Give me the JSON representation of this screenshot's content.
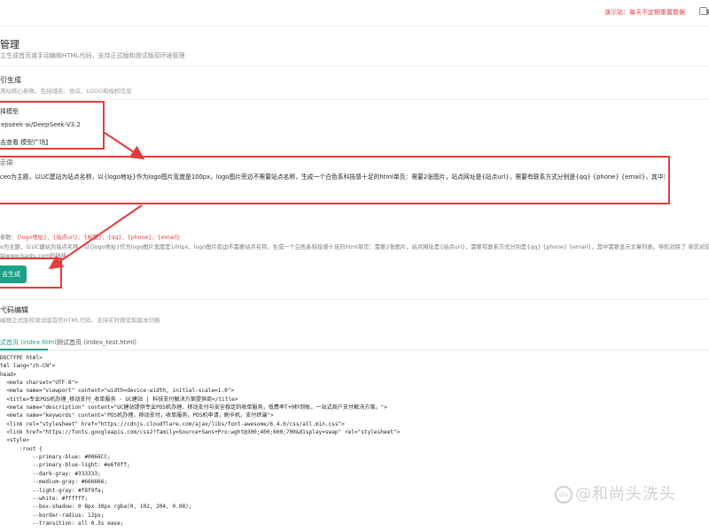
{
  "topbar": {
    "demo_notice": "演示站：每天不定期重置数据",
    "tail_text": "量"
  },
  "header": {
    "title": "管理",
    "subtitle": "立生成首页或手动编辑HTML代码，支持正式版和测试版双环境管理"
  },
  "generate_section": {
    "title": "引生成",
    "subtitle": "用站核心参数，包括域名、协议、LOGO和授权信息",
    "model_label": "择模型",
    "model_value": "epseek-ai/DeepSeek-V3.2",
    "model_link": "击查看 模型广场】",
    "prompt_label": "示词",
    "prompt_text": "ceo为主题，以UC建站为站点名称，以{logo地址}作为logo图片宽度是100px，logo图片旁边不需要站点名称，生成一个白色系科技感十足的html单页：需要2张图片，站点网址是{站点url}，需要有联系方式分别是{qq} {phone} {email}，其中需要显示文章列表。",
    "params_prefix": "参数：",
    "params_tags": "{logo地址}、{站点url}、{标题}、{qq}、{phone}、{email}",
    "example_line": "o为主题，以UC建站为站点名称，以{logo地址}作为logo图片宽度是100px，logo图片旁边不需要站点名称，生成一个白色系科技感十足的html单页：需要2张图片，站点网址是{站点url}，需要有联系方式分别是{qq} {phone} {email}，其中需要显示文章列表。导航对除了 单页对应面",
    "url_prefix": "站",
    "url_text": "www.baidu.com",
    "url_suffix": "的链接",
    "button_label": "击生成"
  },
  "editor_section": {
    "title": "弋码编辑",
    "subtitle": "编辑正式版和测试版首页HTML代码，支持实时预览和版本切换",
    "tabs": [
      {
        "label": "式首页 (index.html)"
      },
      {
        "label": "测试首页 (index_test.html)"
      }
    ],
    "code_lines": [
      "DOCTYPE html>",
      "tml lang=\"zh-CN\">",
      "head>",
      "  <meta charset=\"UTF-8\">",
      "  <meta name=\"viewport\" content=\"width=device-width, initial-scale=1.0\">",
      "  <title>专业POS机办理_移动支付_收单服务 - UC建站 | 科技支付解决方案提供商</title>",
      "  <meta name=\"description\" content=\"UC建站提供专业POS机办理、移动支付与安全稳定的收单服务，低费率T+0秒到账，一站式商户支付解决方案。\">",
      "  <meta name=\"keywords\" content=\"POS机办理，移动支付，收单服务，POS机申请，刷卡机，支付终端\">",
      "  <link rel=\"stylesheet\" href=\"https://cdnjs.cloudflare.com/ajax/libs/font-awesome/6.4.0/css/all.min.css\">",
      "  <link href=\"https://fonts.googleapis.com/css2?family=Source+Sans+Pro:wght@300;400;600;700&display=swap\" rel=\"stylesheet\">",
      "  <style>",
      "      :root {",
      "          --primary-blue: #0066CC;",
      "          --primary-blue-light: #e6f0ff;",
      "          --dark-gray: #333333;",
      "          --medium-gray: #666666;",
      "          --light-gray: #f8f9fa;",
      "          --white: #ffffff;",
      "          --box-shadow: 0 8px 30px rgba(0, 102, 204, 0.08);",
      "          --border-radius: 12px;",
      "          --transition: all 0.3s ease;"
    ]
  },
  "watermark": {
    "logo_text": "du",
    "text": "@和尚头洗头"
  },
  "colors": {
    "accent": "#1aa188",
    "annotation_red": "#e23c3c",
    "notice_red": "#e23c3c"
  },
  "icons": {
    "topbar": "notification-icon",
    "watermark": "watermark-logo-icon"
  }
}
